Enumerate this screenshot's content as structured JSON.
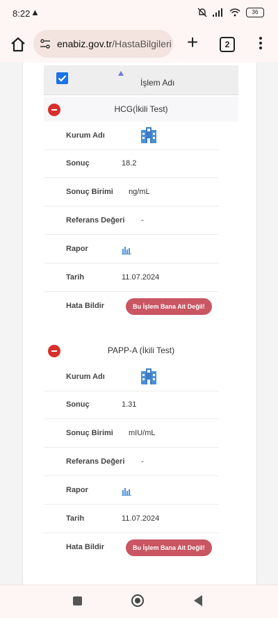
{
  "status_bar": {
    "time": "8:22",
    "battery": "36"
  },
  "browser": {
    "url_host": "enabiz.gov.tr",
    "url_path": "/HastaBilgileri",
    "tab_count": "2"
  },
  "table": {
    "column_label": "İşlem Adı"
  },
  "records": [
    {
      "title": "HCG(İkili Test)",
      "labels": {
        "institution": "Kurum Adı",
        "result": "Sonuç",
        "unit": "Sonuç Birimi",
        "reference": "Referans Değeri",
        "report": "Rapor",
        "date": "Tarih",
        "report_error": "Hata Bildir"
      },
      "result": "18.2",
      "unit": "ng/mL",
      "reference": "-",
      "date": "11.07.2024",
      "not_mine_button": "Bu İşlem Bana Ait Değil!"
    },
    {
      "title": "PAPP-A (İkili Test)",
      "labels": {
        "institution": "Kurum Adı",
        "result": "Sonuç",
        "unit": "Sonuç Birimi",
        "reference": "Referans Değeri",
        "report": "Rapor",
        "date": "Tarih",
        "report_error": "Hata Bildir"
      },
      "result": "1.31",
      "unit": "mIU/mL",
      "reference": "-",
      "date": "11.07.2024",
      "not_mine_button": "Bu İşlem Bana Ait Değil!"
    }
  ],
  "colors": {
    "accent": "#c95662",
    "minus": "#d9302c",
    "checkbox": "#1a73e8",
    "icon": "#4a90d9"
  }
}
